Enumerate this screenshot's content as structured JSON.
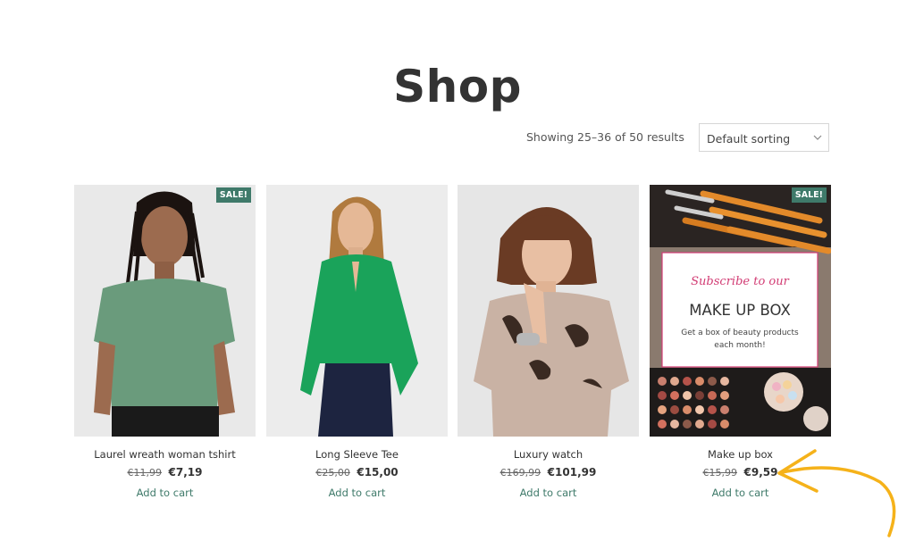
{
  "page_title": "Shop",
  "result_count": "Showing 25–36 of 50 results",
  "sorting": {
    "selected": "Default sorting"
  },
  "colors": {
    "accent": "#3f7a6a",
    "annotation": "#f5b21a"
  },
  "products": [
    {
      "title": "Laurel wreath woman tshirt",
      "old_price": "€11,99",
      "price": "€7,19",
      "sale": "SALE!",
      "cart": "Add to cart"
    },
    {
      "title": "Long Sleeve Tee",
      "old_price": "€25,00",
      "price": "€15,00",
      "cart": "Add to cart"
    },
    {
      "title": "Luxury watch",
      "old_price": "€169,99",
      "price": "€101,99",
      "cart": "Add to cart"
    },
    {
      "title": "Make up box",
      "old_price": "€15,99",
      "price": "€9,59",
      "sale": "SALE!",
      "cart": "Add to cart",
      "promo": {
        "script": "Subscribe to our",
        "heading": "MAKE UP BOX",
        "text_line1": "Get a box of beauty products",
        "text_line2": "each month!"
      }
    }
  ]
}
